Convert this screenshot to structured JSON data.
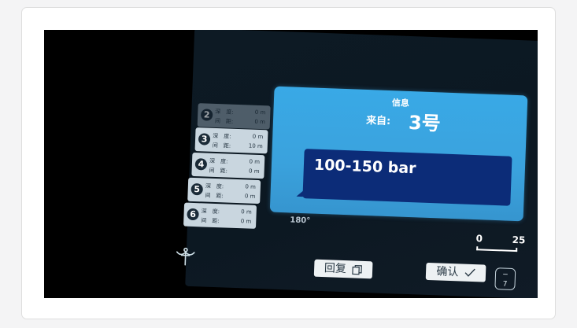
{
  "dialog": {
    "title": "信息",
    "from_label": "来自:",
    "from_value": "3号",
    "message": "100-150 bar"
  },
  "divers": [
    {
      "num": "2",
      "depth_label": "深　度:",
      "depth": "0 m",
      "dist_label": "间　距:",
      "dist": "0 m",
      "dim": true
    },
    {
      "num": "3",
      "depth_label": "深　度:",
      "depth": "0 m",
      "dist_label": "间　距:",
      "dist": "10 m"
    },
    {
      "num": "4",
      "depth_label": "深　度:",
      "depth": "0 m",
      "dist_label": "间　距:",
      "dist": "0 m"
    },
    {
      "num": "5",
      "depth_label": "深　度:",
      "depth": "0 m",
      "dist_label": "间　距:",
      "dist": "0 m"
    },
    {
      "num": "6",
      "depth_label": "深　度:",
      "depth": "0 m",
      "dist_label": "间　距:",
      "dist": "0 m"
    }
  ],
  "compass_label": "180°",
  "scale": {
    "left": "0",
    "right": "25"
  },
  "buttons": {
    "reply": "回复",
    "confirm": "确认",
    "small_top": "−",
    "small_bottom": "7"
  },
  "icons": {
    "anchor": "anchor-icon",
    "reply": "copy-icon",
    "confirm": "check-icon"
  },
  "colors": {
    "dialog": "#39a9e6",
    "message_box": "#0c2c78",
    "screen_bg": "#0d1a24"
  }
}
